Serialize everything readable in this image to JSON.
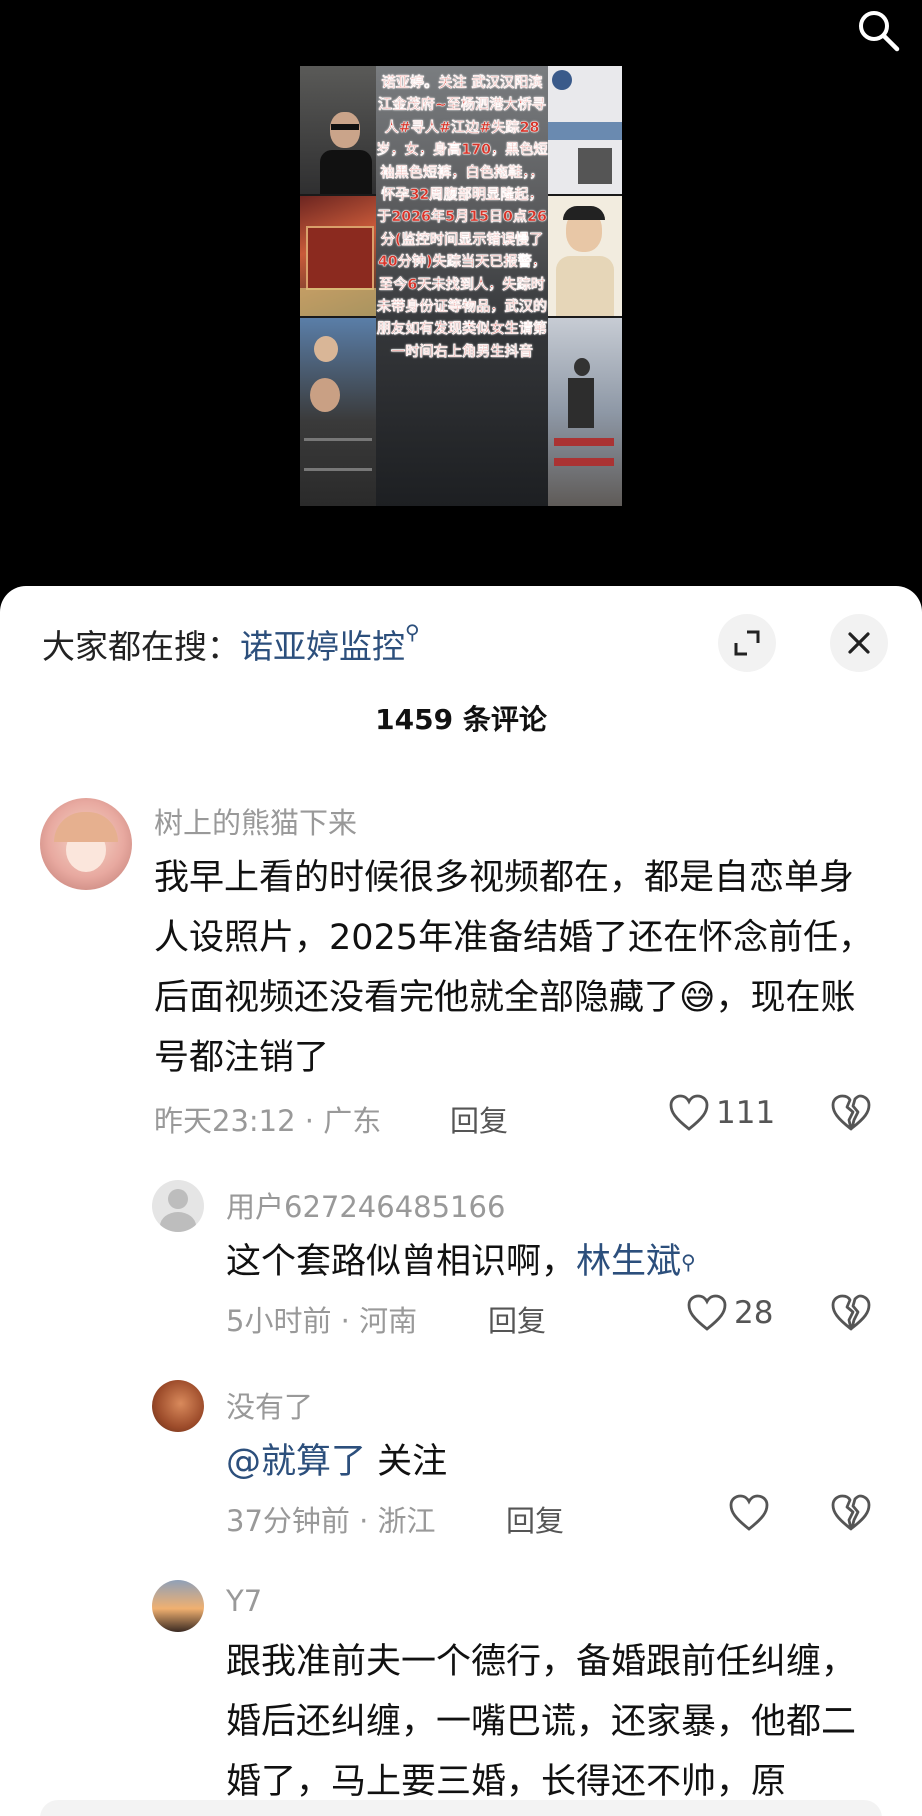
{
  "video": {
    "overlay_text": "诺亚婷。关注 武汉汉阳滨江金茂府~至杨泗港大桥寻人#寻人#江边#失踪28岁，女，身高170，黑色短袖黑色短裤，白色拖鞋，，怀孕32周腹部明显隆起，于2026年5月15日0点26分(监控时间显示错误慢了40分钟)失踪当天已报警，至今6天未找到人，失踪时未带身份证等物品，武汉的朋友如有发现类似女生请第一时间右上角男生抖音"
  },
  "hot_search": {
    "prefix": "大家都在搜：",
    "keyword": "诺亚婷监控",
    "keyword_icon": "search-small-icon"
  },
  "comments_count": "1459 条评论",
  "comments": [
    {
      "user": "树上的熊猫下来",
      "text1": "我早上看的时候很多视频都在，都是自恋单身人设照片，2025年准备结婚了还在怀念前任，后面视频还没看完他就全部隐藏了",
      "text2": "，现在账号都注销了",
      "emoji": "😅",
      "time": "昨天23:12 · 广东",
      "reply": "回复",
      "likes": "111"
    },
    {
      "user": "用户627246485166",
      "text": "这个套路似曾相识啊，",
      "mention": "林生斌",
      "time": "5小时前 · 河南",
      "reply": "回复",
      "likes": "28"
    },
    {
      "user": "没有了",
      "mention": "@就算了",
      "text": " 关注",
      "time": "37分钟前 · 浙江",
      "reply": "回复",
      "likes": ""
    },
    {
      "user": "Y7",
      "text": "跟我准前夫一个德行，备婚跟前任纠缠，婚后还纠缠，一嘴巴谎，还家暴，他都二婚了，马上要三婚，长得还不帅，原"
    }
  ]
}
